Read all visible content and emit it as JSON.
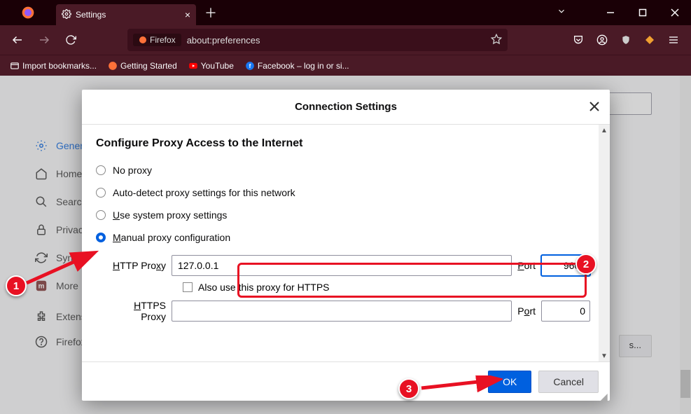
{
  "window": {
    "tab_title": "Settings",
    "url": "about:preferences",
    "url_prefix": "Firefox"
  },
  "bookmarks_bar": {
    "import": "Import bookmarks...",
    "items": [
      {
        "label": "Getting Started"
      },
      {
        "label": "YouTube"
      },
      {
        "label": "Facebook – log in or si..."
      }
    ]
  },
  "sidebar": {
    "items": [
      {
        "label": "General"
      },
      {
        "label": "Home"
      },
      {
        "label": "Search"
      },
      {
        "label": "Privacy"
      },
      {
        "label": "Sync"
      },
      {
        "label": "More"
      },
      {
        "label": "Extensions"
      },
      {
        "label": "Firefox"
      }
    ]
  },
  "extras_button": "s...",
  "dialog": {
    "title": "Connection Settings",
    "heading": "Configure Proxy Access to the Internet",
    "options": {
      "no_proxy": "No proxy",
      "auto_detect": "Auto-detect proxy settings for this network",
      "use_system_prefix": "U",
      "use_system_rest": "se system proxy settings",
      "manual_prefix": "M",
      "manual_rest": "anual proxy configuration"
    },
    "http": {
      "label": "HTTP Proxy",
      "value": "127.0.0.1",
      "port_prefix": "P",
      "port_rest": "ort",
      "port_value": "9666"
    },
    "also_https": "Also use this proxy for HTTPS",
    "https": {
      "label_prefix": "H",
      "label_rest": "TTPS Proxy",
      "value": "",
      "port_prefix": "P",
      "port_rest": "ort",
      "port_value": "0"
    },
    "ok": "OK",
    "cancel": "Cancel"
  },
  "annotations": {
    "c1": "1",
    "c2": "2",
    "c3": "3"
  }
}
